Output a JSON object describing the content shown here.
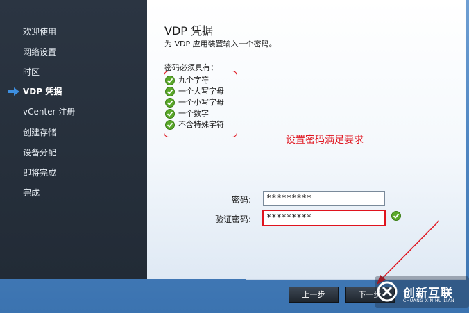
{
  "sidebar": {
    "items": [
      {
        "label": "欢迎使用"
      },
      {
        "label": "网络设置"
      },
      {
        "label": "时区"
      },
      {
        "label": "VDP 凭据"
      },
      {
        "label": "vCenter 注册"
      },
      {
        "label": "创建存储"
      },
      {
        "label": "设备分配"
      },
      {
        "label": "即将完成"
      },
      {
        "label": "完成"
      }
    ],
    "active_index": 3
  },
  "main": {
    "title": "VDP 凭据",
    "subtitle": "为 VDP 应用装置输入一个密码。",
    "requirements_heading": "密码必须具有：",
    "requirements": [
      "九个字符",
      "一个大写字母",
      "一个小写字母",
      "一个数字",
      "不含特殊字符"
    ],
    "annotation_note": "设置密码满足要求",
    "password": {
      "label": "密码:",
      "value": "*********"
    },
    "confirm_password": {
      "label": "验证密码:",
      "value": "*********"
    }
  },
  "footer": {
    "back_label": "上一步",
    "next_label": "下一步"
  },
  "watermark": {
    "text": "创新互联",
    "subtext": "CHUANG XIN HU LIAN"
  },
  "colors": {
    "annotation_red": "#e0141e",
    "check_green": "#5aa82a",
    "sidebar_bg": "#2b3542",
    "button_bg": "#2a323c"
  },
  "icons": {
    "active_indicator": "arrow-right-icon",
    "requirement": "check-circle-icon"
  }
}
